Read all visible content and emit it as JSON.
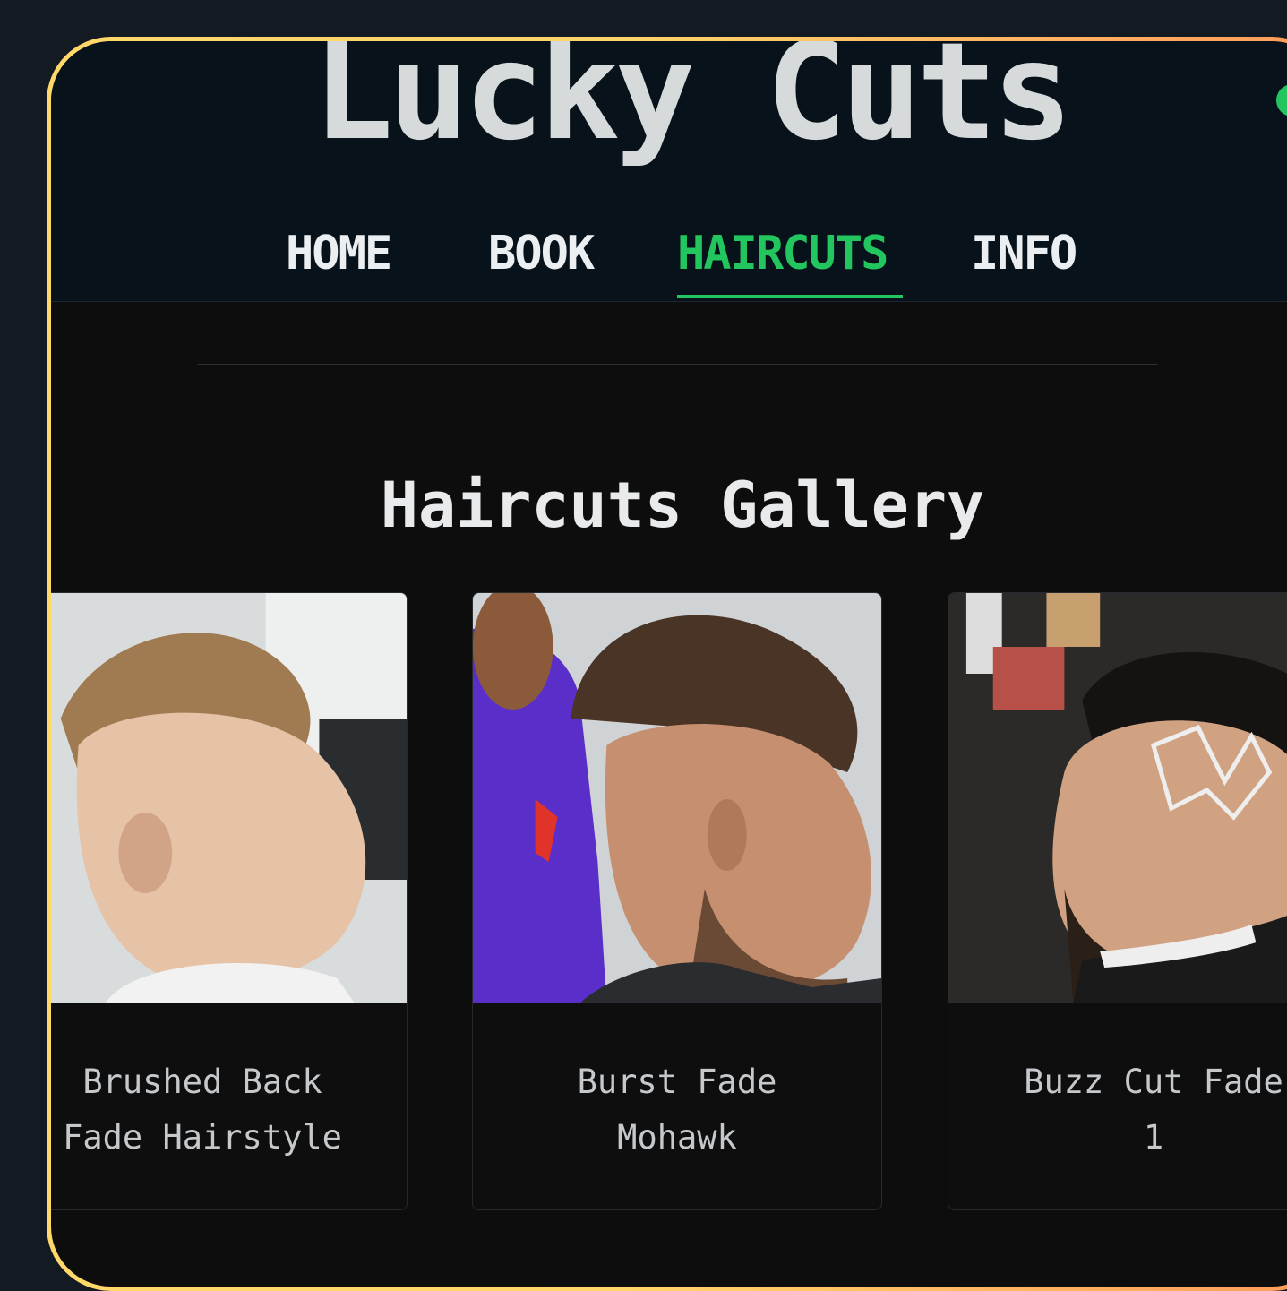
{
  "header": {
    "logo": "Lucky Cuts",
    "nav": [
      {
        "label": "HOME"
      },
      {
        "label": "BOOK"
      },
      {
        "label": "HAIRCUTS",
        "active": true
      },
      {
        "label": "INFO"
      }
    ]
  },
  "main": {
    "title": "Haircuts Gallery",
    "cards": [
      {
        "line1": "Brushed Back",
        "line2": "Fade Hairstyle"
      },
      {
        "line1": "Burst Fade",
        "line2": "Mohawk"
      },
      {
        "line1": "Buzz Cut Fade",
        "line2": "1"
      }
    ]
  },
  "colors": {
    "accent": "#22c55e",
    "header_bg": "#07121a",
    "page_bg": "#0d0d0d",
    "frame_gradient_start": "#ffd86a",
    "frame_gradient_end": "#ff9a5a"
  }
}
